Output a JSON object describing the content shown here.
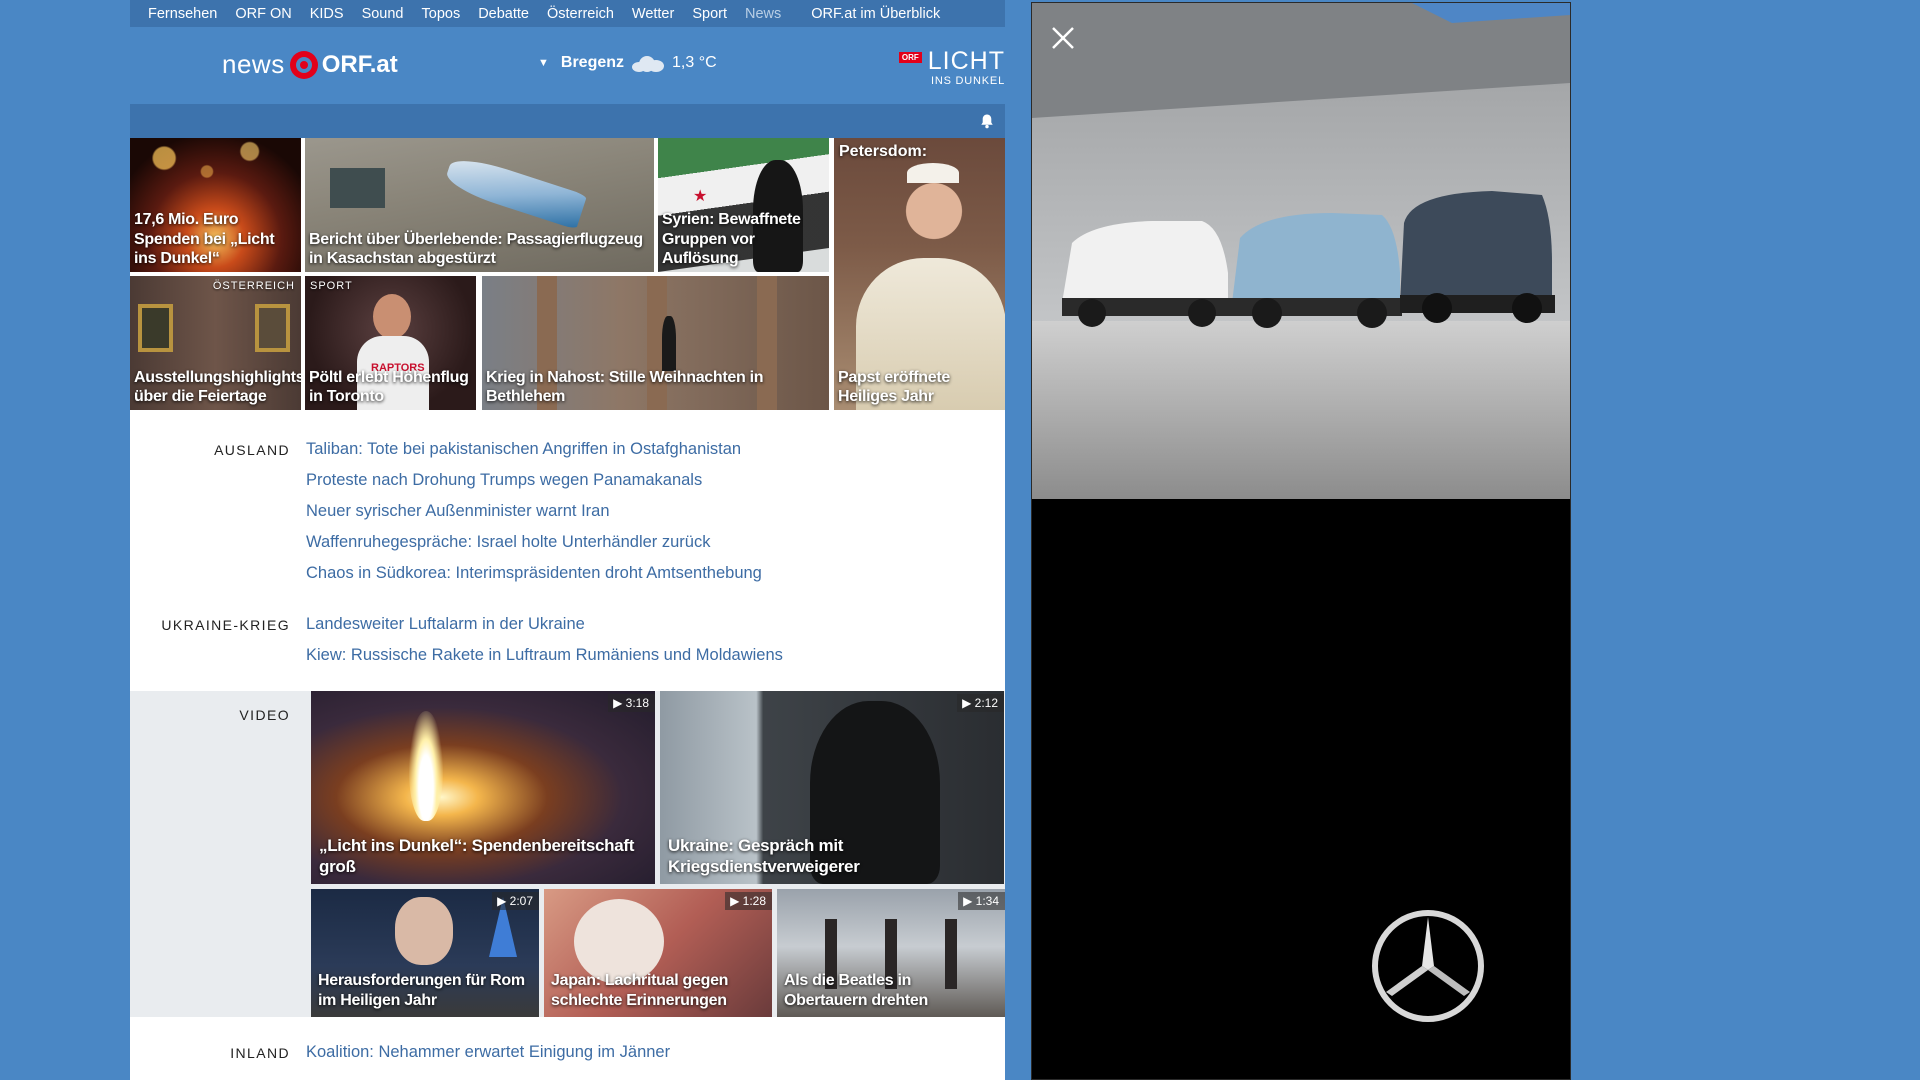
{
  "nav": {
    "items": [
      {
        "label": "Fernsehen"
      },
      {
        "label": "ORF ON"
      },
      {
        "label": "KIDS"
      },
      {
        "label": "Sound"
      },
      {
        "label": "Topos"
      },
      {
        "label": "Debatte"
      },
      {
        "label": "Österreich"
      },
      {
        "label": "Wetter"
      },
      {
        "label": "Sport"
      },
      {
        "label": "News"
      }
    ],
    "overview": "ORF.at im Überblick"
  },
  "header": {
    "logo_news": "news",
    "logo_orf": "ORF.at",
    "weather": {
      "location": "Bregenz",
      "temperature": "1,3 °C",
      "icon": "cloud-icon"
    },
    "licht": {
      "badge": "ORF",
      "title": "LICHT",
      "subtitle": "INS DUNKEL"
    }
  },
  "toolbar": {
    "bell_icon": "bell-icon"
  },
  "tiles": [
    {
      "title": "17,6 Mio. Euro Spenden bei „Licht ins Dunkel“",
      "kicker": ""
    },
    {
      "title": "Bericht über Überlebende: Passagierflugzeug in Kasachstan abgestürzt",
      "kicker": ""
    },
    {
      "title": "Syrien: Bewaffnete Gruppen vor Auflösung",
      "kicker": ""
    },
    {
      "title": "Papst eröffnete Heiliges Jahr",
      "label": "Petersdom:"
    },
    {
      "title": "Ausstellungshighlights über die Feiertage",
      "kicker": "ÖSTERREICH"
    },
    {
      "title": "Pöltl erlebt Höhenflug in Toronto",
      "kicker": "SPORT"
    },
    {
      "title": "Krieg in Nahost: Stille Weihnachten in Bethlehem",
      "kicker": ""
    }
  ],
  "sections": {
    "ausland": {
      "label": "AUSLAND",
      "links": [
        "Taliban: Tote bei pakistanischen Angriffen in Ostafghanistan",
        "Proteste nach Drohung Trumps wegen Panamakanals",
        "Neuer syrischer Außenminister warnt Iran",
        "Waffenruhegespräche: Israel holte Unterhändler zurück",
        "Chaos in Südkorea: Interimspräsidenten droht Amtsenthebung"
      ]
    },
    "ukraine": {
      "label": "UKRAINE-KRIEG",
      "links": [
        "Landesweiter Luftalarm in der Ukraine",
        "Kiew: Russische Rakete in Luftraum Rumäniens und Moldawiens"
      ]
    },
    "video": {
      "label": "VIDEO",
      "items": [
        {
          "title": "„Licht ins Dunkel“: Spendenbereitschaft groß",
          "duration": "3:18"
        },
        {
          "title": "Ukraine: Gespräch mit Kriegsdienstverweigerer",
          "duration": "2:12"
        },
        {
          "title": "Herausforderungen für Rom im Heiligen Jahr",
          "duration": "2:07"
        },
        {
          "title": "Japan: Lachritual gegen schlechte Erinnerungen",
          "duration": "1:28"
        },
        {
          "title": "Als die Beatles in Obertauern drehten",
          "duration": "1:34"
        }
      ]
    },
    "inland": {
      "label": "INLAND",
      "links": [
        "Koalition: Nehammer erwartet Einigung im Jänner"
      ]
    }
  },
  "ad": {
    "close_icon": "close-icon",
    "brand_icon": "mercedes-star-icon"
  },
  "colors": {
    "page_bg": "#4a87c5",
    "bar": "#3d73ad",
    "link": "#3d6ca4",
    "orf_red": "#e2001a"
  }
}
